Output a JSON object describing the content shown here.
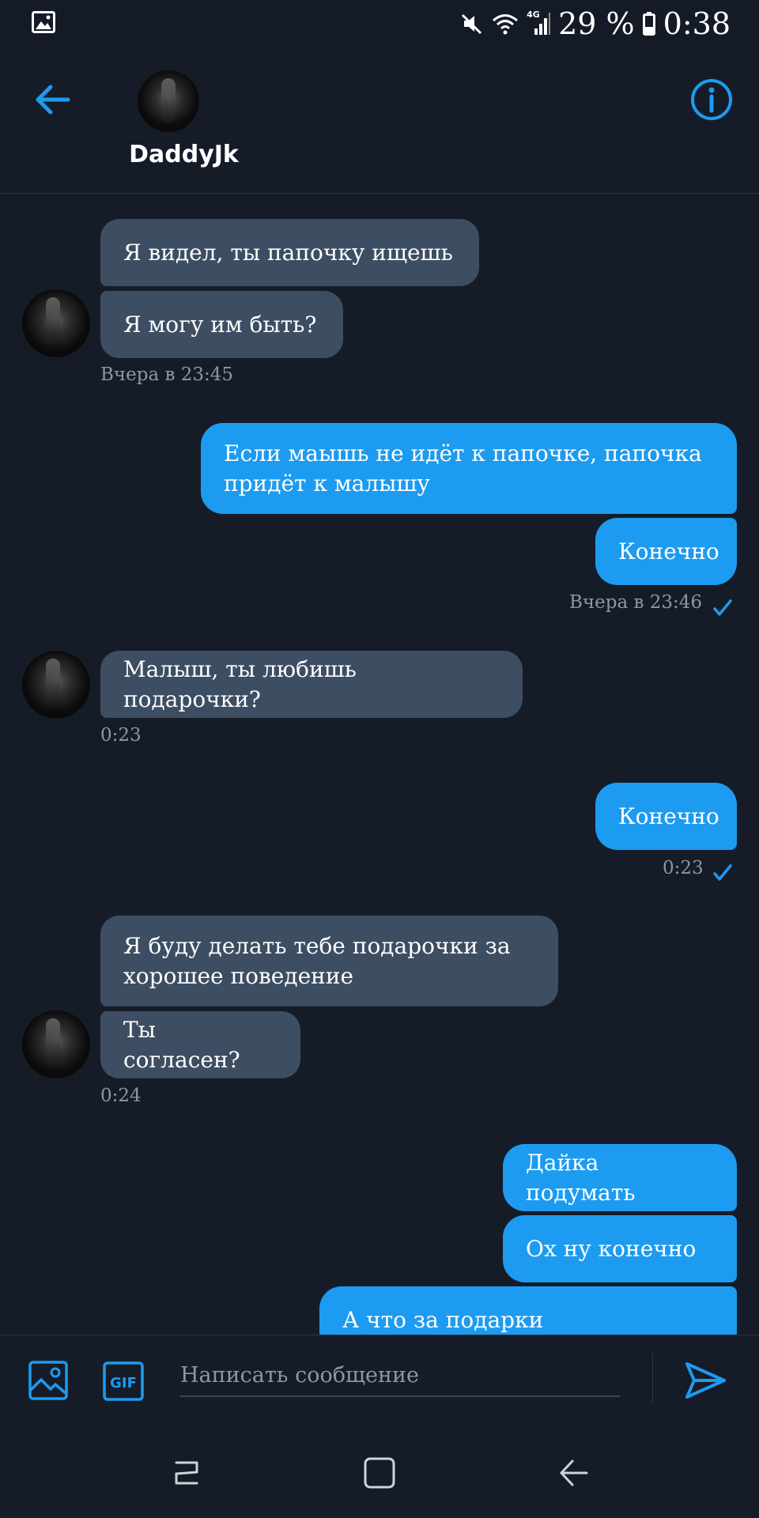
{
  "status_bar": {
    "battery": "29 %",
    "time": "0:38",
    "network": "4G"
  },
  "header": {
    "contact_name": "DaddyJk"
  },
  "messages": [
    {
      "side": "in",
      "text": "Я видел, ты папочку ищешь"
    },
    {
      "side": "in",
      "text": "Я могу им быть?"
    },
    {
      "side": "in",
      "timestamp": "Вчера в 23:45"
    },
    {
      "side": "out",
      "text_line1": "Если маышь не идёт к папочке, папочка",
      "text_line2": "придёт к малышу"
    },
    {
      "side": "out",
      "text": "Конечно"
    },
    {
      "side": "out",
      "timestamp": "Вчера в 23:46"
    },
    {
      "side": "in",
      "text": "Малыш, ты любишь подарочки?"
    },
    {
      "side": "in",
      "timestamp": "0:23"
    },
    {
      "side": "out",
      "text": "Конечно"
    },
    {
      "side": "out",
      "timestamp": "0:23"
    },
    {
      "side": "in",
      "text_line1": "Я буду делать тебе подарочки за",
      "text_line2": "хорошее поведение"
    },
    {
      "side": "in",
      "text": "Ты согласен?"
    },
    {
      "side": "in",
      "timestamp": "0:24"
    },
    {
      "side": "out",
      "text": "Дайка подумать"
    },
    {
      "side": "out",
      "text": "Ох ну конечно"
    },
    {
      "side": "out",
      "text": "А что за подарки"
    }
  ],
  "composer": {
    "placeholder": "Написать сообщение",
    "gif_label": "GIF"
  },
  "colors": {
    "background": "#151c28",
    "incoming_bubble": "#3d4e63",
    "outgoing_bubble": "#1d9bf0",
    "accent": "#1d9bf0",
    "timestamp": "#8899a6"
  }
}
